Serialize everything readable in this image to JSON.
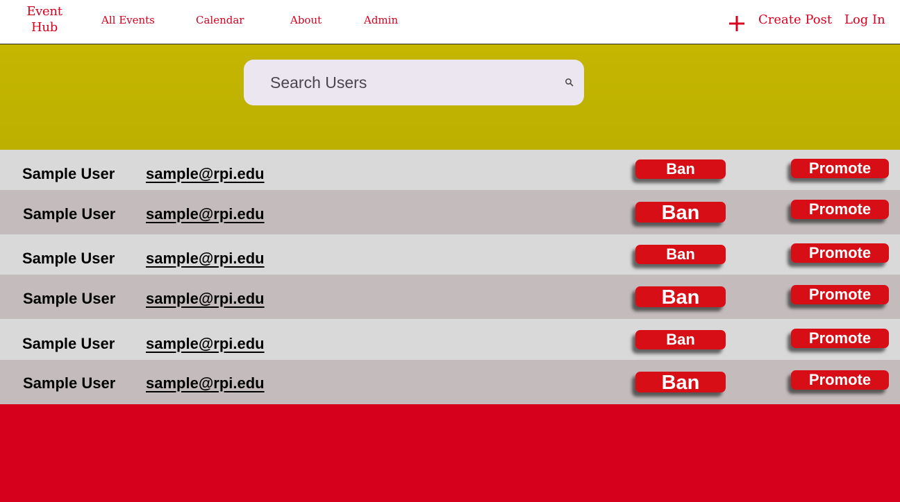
{
  "nav": {
    "brand_line1": "Event",
    "brand_line2": "Hub",
    "links": [
      "All Events",
      "Calendar",
      "About",
      "Admin"
    ],
    "create_post": "Create Post",
    "log_in": "Log In"
  },
  "search": {
    "placeholder": "Search Users"
  },
  "users": [
    {
      "name": "Sample User",
      "email": "sample@rpi.edu",
      "ban": "Ban",
      "promote": "Promote"
    },
    {
      "name": "Sample User",
      "email": "sample@rpi.edu",
      "ban": "Ban",
      "promote": "Promote"
    },
    {
      "name": "Sample User",
      "email": "sample@rpi.edu",
      "ban": "Ban",
      "promote": "Promote"
    },
    {
      "name": "Sample User",
      "email": "sample@rpi.edu",
      "ban": "Ban",
      "promote": "Promote"
    },
    {
      "name": "Sample User",
      "email": "sample@rpi.edu",
      "ban": "Ban",
      "promote": "Promote"
    },
    {
      "name": "Sample User",
      "email": "sample@rpi.edu",
      "ban": "Ban",
      "promote": "Promote"
    }
  ],
  "colors": {
    "brand_red": "#d7001f",
    "hero_olive": "#c4b601",
    "row_light": "#d9d9d9",
    "row_dark": "#c4bcbc",
    "button_red": "#d80e16",
    "footer_red": "#d7001c"
  },
  "icons": {
    "create": "plus-icon",
    "search": "search-icon"
  }
}
